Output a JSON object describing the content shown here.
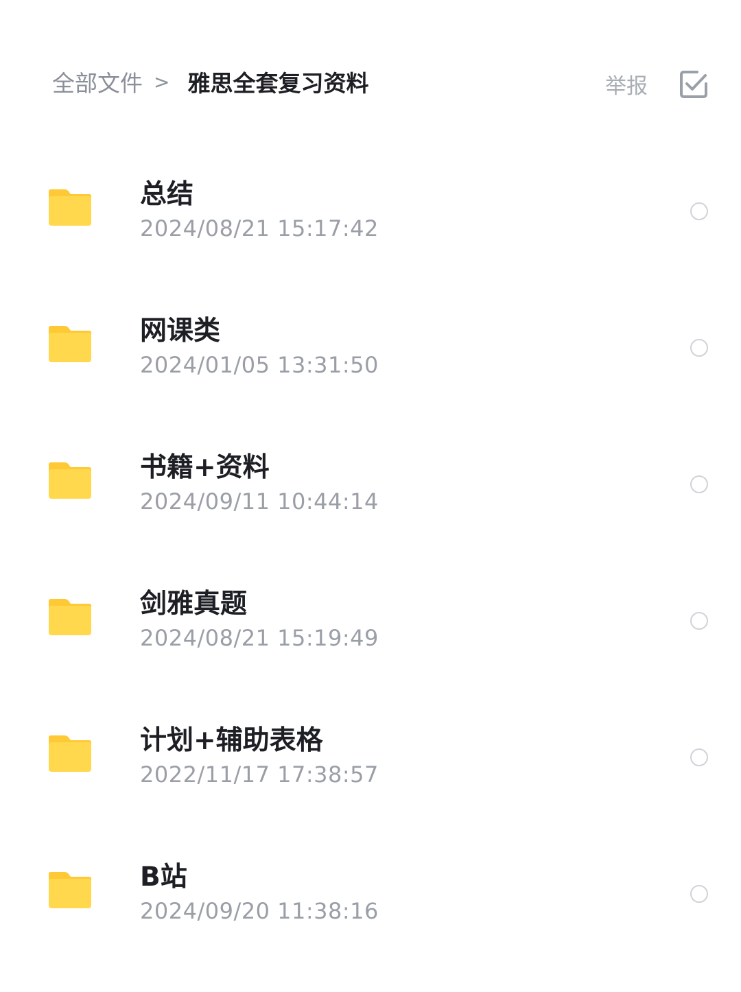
{
  "header": {
    "breadcrumb_root": "全部文件",
    "breadcrumb_separator": ">",
    "breadcrumb_current": "雅思全套复习资料",
    "report_label": "举报",
    "select_icon": "checkbox-check-icon"
  },
  "files": [
    {
      "name": "总结",
      "time": "2024/08/21 15:17:42",
      "icon": "folder-icon"
    },
    {
      "name": "网课类",
      "time": "2024/01/05 13:31:50",
      "icon": "folder-icon"
    },
    {
      "name": "书籍+资料",
      "time": "2024/09/11 10:44:14",
      "icon": "folder-icon"
    },
    {
      "name": "剑雅真题",
      "time": "2024/08/21 15:19:49",
      "icon": "folder-icon"
    },
    {
      "name": "计划+辅助表格",
      "time": "2022/11/17 17:38:57",
      "icon": "folder-icon"
    },
    {
      "name": "B站",
      "time": "2024/09/20 11:38:16",
      "icon": "folder-icon"
    }
  ],
  "colors": {
    "folder": "#FFD84D",
    "folder_tab": "#FFC935",
    "primary_text": "#1D1F24",
    "secondary_text": "#9A9EA6"
  }
}
